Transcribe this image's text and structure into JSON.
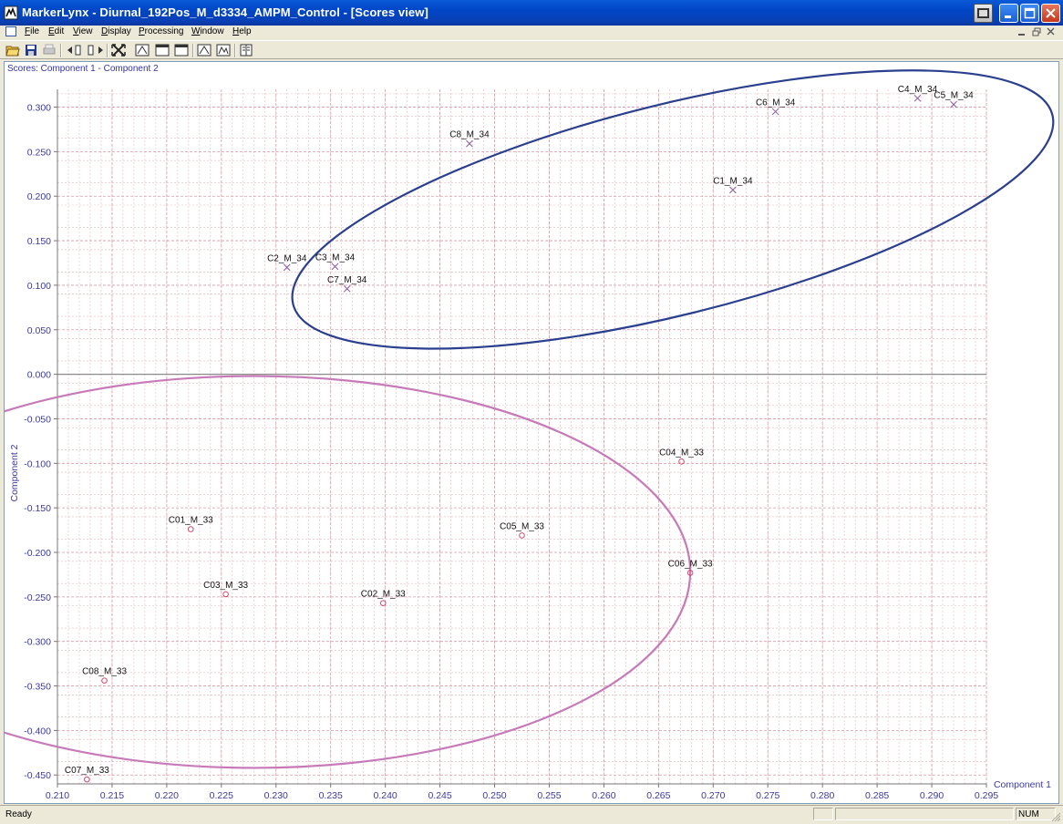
{
  "window": {
    "title": "MarkerLynx - Diurnal_192Pos_M_d3334_AMPM_Control - [Scores view]"
  },
  "menu": {
    "items": [
      {
        "label": "File",
        "underline": "F",
        "rest": "ile"
      },
      {
        "label": "Edit",
        "underline": "E",
        "rest": "dit"
      },
      {
        "label": "View",
        "underline": "V",
        "rest": "iew"
      },
      {
        "label": "Display",
        "underline": "D",
        "rest": "isplay"
      },
      {
        "label": "Processing",
        "underline": "P",
        "rest": "rocessing"
      },
      {
        "label": "Window",
        "underline": "W",
        "rest": "indow"
      },
      {
        "label": "Help",
        "underline": "H",
        "rest": "elp"
      }
    ]
  },
  "toolbar": {
    "icons": [
      "open-folder-icon",
      "save-icon",
      "print-icon",
      "shift-left-icon",
      "shift-right-icon",
      "zoom-fit-icon",
      "peak-view-icon",
      "window-view-icon",
      "window-view-2-icon",
      "spectrum-icon",
      "spectrum-2-icon",
      "book-icon"
    ]
  },
  "plot": {
    "title": "Scores: Component 1 - Component 2"
  },
  "chart_data": {
    "type": "scatter",
    "title": "Scores: Component 1 - Component 2",
    "xlabel": "Component 1",
    "ylabel": "Component 2",
    "xlim": [
      0.21,
      0.295
    ],
    "ylim": [
      -0.46,
      0.32
    ],
    "x_ticks": [
      0.21,
      0.215,
      0.22,
      0.225,
      0.23,
      0.235,
      0.24,
      0.245,
      0.25,
      0.255,
      0.26,
      0.265,
      0.27,
      0.275,
      0.28,
      0.285,
      0.29,
      0.295
    ],
    "x_tick_labels": [
      "0.210",
      "0.215",
      "0.220",
      "0.225",
      "0.230",
      "0.235",
      "0.240",
      "0.245",
      "0.250",
      "0.255",
      "0.260",
      "0.265",
      "0.270",
      "0.275",
      "0.280",
      "0.285",
      "0.290",
      "0.295"
    ],
    "y_ticks": [
      0.3,
      0.25,
      0.2,
      0.15,
      0.1,
      0.05,
      0.0,
      -0.05,
      -0.1,
      -0.15,
      -0.2,
      -0.25,
      -0.3,
      -0.35,
      -0.4,
      -0.45
    ],
    "y_tick_labels": [
      "0.300",
      "0.250",
      "0.200",
      "0.150",
      "0.100",
      "0.050",
      "0.000",
      "-0.050",
      "-0.100",
      "-0.150",
      "-0.200",
      "-0.250",
      "-0.300",
      "-0.350",
      "-0.400",
      "-0.450"
    ],
    "grid": true,
    "series": [
      {
        "marker": "x",
        "color": "#8a5aa0",
        "points": [
          {
            "label": "C4_M_34",
            "x": 0.2887,
            "y": 0.31
          },
          {
            "label": "C5_M_34",
            "x": 0.292,
            "y": 0.303
          },
          {
            "label": "C6_M_34",
            "x": 0.2757,
            "y": 0.295
          },
          {
            "label": "C8_M_34",
            "x": 0.2477,
            "y": 0.259
          },
          {
            "label": "C1_M_34",
            "x": 0.2718,
            "y": 0.207
          },
          {
            "label": "C2_M_34",
            "x": 0.231,
            "y": 0.12
          },
          {
            "label": "C3_M_34",
            "x": 0.2354,
            "y": 0.121
          },
          {
            "label": "C7_M_34",
            "x": 0.2365,
            "y": 0.096
          }
        ]
      },
      {
        "marker": "o",
        "color": "#d04a6a",
        "points": [
          {
            "label": "C04_M_33",
            "x": 0.2671,
            "y": -0.098
          },
          {
            "label": "C01_M_33",
            "x": 0.2222,
            "y": -0.174
          },
          {
            "label": "C05_M_33",
            "x": 0.2525,
            "y": -0.181
          },
          {
            "label": "C06_M_33",
            "x": 0.2679,
            "y": -0.223
          },
          {
            "label": "C03_M_33",
            "x": 0.2254,
            "y": -0.247
          },
          {
            "label": "C02_M_33",
            "x": 0.2398,
            "y": -0.257
          },
          {
            "label": "C08_M_33",
            "x": 0.2143,
            "y": -0.344
          },
          {
            "label": "C07_M_33",
            "x": 0.2127,
            "y": -0.455
          }
        ]
      }
    ],
    "ellipses": [
      {
        "color": "#2b3f8f",
        "cx": 0.2663,
        "cy": 0.185,
        "rx": 0.0358,
        "ry": 0.118,
        "angle_deg": -14
      },
      {
        "color": "#c77ab8",
        "cx": 0.228,
        "cy": -0.222,
        "rx": 0.0399,
        "ry": 0.22,
        "angle_deg": 0
      }
    ]
  },
  "status": {
    "ready": "Ready",
    "num": "NUM"
  }
}
